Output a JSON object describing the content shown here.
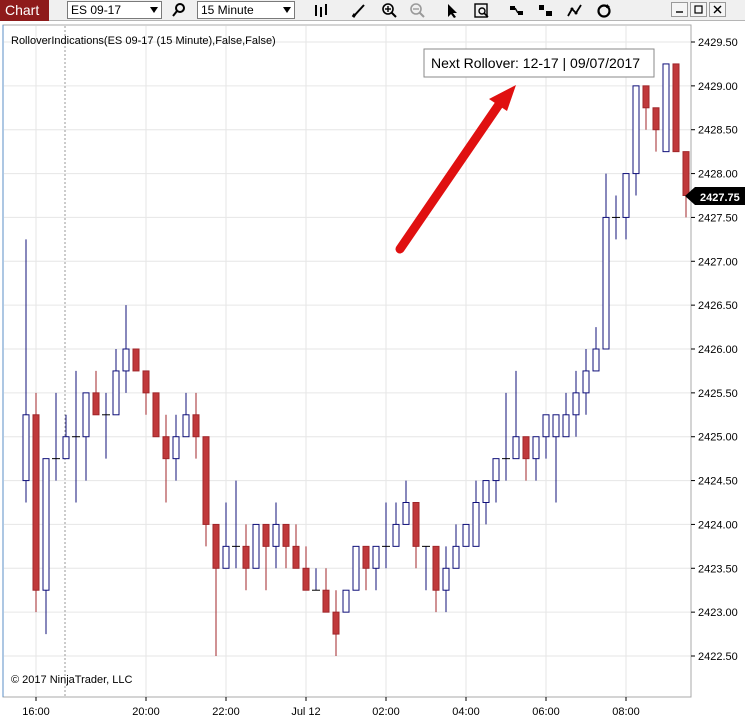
{
  "toolbar": {
    "chart_tab": "Chart",
    "instrument": "ES 09-17",
    "interval": "15 Minute",
    "icons": [
      "search-icon",
      "bar-type-icon",
      "draw-icon",
      "zoom-in-icon",
      "zoom-out-icon",
      "pointer-icon",
      "data-box-icon",
      "strategies-icon",
      "chart-style-icon",
      "indicators-icon",
      "refresh-icon"
    ]
  },
  "chart": {
    "indicator_label": "RolloverIndications(ES 09-17 (15 Minute),False,False)",
    "annotation": "Next Rollover: 12-17 | 09/07/2017",
    "copyright": "© 2017 NinjaTrader, LLC",
    "last_price": "2427.75",
    "colors": {
      "up": "#ffffff",
      "down": "#c0393b",
      "outline": "#10107a",
      "wick_down": "#a0262a",
      "arrow": "#e01010",
      "tag": "#000000"
    }
  },
  "chart_data": {
    "type": "candlestick",
    "y_ticks": [
      "2422.50",
      "2423.00",
      "2423.50",
      "2424.00",
      "2424.50",
      "2425.00",
      "2425.50",
      "2426.00",
      "2426.50",
      "2427.00",
      "2427.50",
      "2428.00",
      "2428.50",
      "2429.00",
      "2429.50"
    ],
    "ylim": [
      2422.2,
      2429.8
    ],
    "x_ticks": [
      "16:00",
      "20:00",
      "22:00",
      "Jul 12",
      "02:00",
      "04:00",
      "06:00",
      "08:00"
    ],
    "candles": [
      [
        2424.5,
        2427.25,
        2424.25,
        2425.25
      ],
      [
        2425.25,
        2425.5,
        2423.0,
        2423.25
      ],
      [
        2423.25,
        2424.75,
        2422.75,
        2424.75
      ],
      [
        2424.75,
        2425.5,
        2424.5,
        2424.75
      ],
      [
        2424.75,
        2425.25,
        2424.75,
        2425.0
      ],
      [
        2425.0,
        2425.75,
        2424.25,
        2425.0
      ],
      [
        2425.0,
        2425.5,
        2424.5,
        2425.5
      ],
      [
        2425.5,
        2425.75,
        2425.25,
        2425.25
      ],
      [
        2425.25,
        2425.5,
        2424.75,
        2425.25
      ],
      [
        2425.25,
        2426.0,
        2425.25,
        2425.75
      ],
      [
        2425.75,
        2426.5,
        2425.5,
        2426.0
      ],
      [
        2426.0,
        2426.0,
        2425.75,
        2425.75
      ],
      [
        2425.75,
        2425.75,
        2425.25,
        2425.5
      ],
      [
        2425.5,
        2425.5,
        2425.0,
        2425.0
      ],
      [
        2425.0,
        2425.25,
        2424.25,
        2424.75
      ],
      [
        2424.75,
        2425.25,
        2424.5,
        2425.0
      ],
      [
        2425.0,
        2425.5,
        2425.0,
        2425.25
      ],
      [
        2425.25,
        2425.5,
        2424.75,
        2425.0
      ],
      [
        2425.0,
        2425.0,
        2423.75,
        2424.0
      ],
      [
        2424.0,
        2424.0,
        2422.5,
        2423.5
      ],
      [
        2423.5,
        2424.25,
        2423.5,
        2423.75
      ],
      [
        2423.75,
        2424.5,
        2423.5,
        2423.75
      ],
      [
        2423.75,
        2424.0,
        2423.25,
        2423.5
      ],
      [
        2423.5,
        2424.0,
        2423.5,
        2424.0
      ],
      [
        2424.0,
        2424.0,
        2423.25,
        2423.75
      ],
      [
        2423.75,
        2424.25,
        2423.5,
        2424.0
      ],
      [
        2424.0,
        2424.0,
        2423.5,
        2423.75
      ],
      [
        2423.75,
        2424.0,
        2423.5,
        2423.5
      ],
      [
        2423.5,
        2423.75,
        2423.25,
        2423.25
      ],
      [
        2423.25,
        2423.5,
        2423.25,
        2423.25
      ],
      [
        2423.25,
        2423.5,
        2423.0,
        2423.0
      ],
      [
        2423.0,
        2423.25,
        2422.5,
        2422.75
      ],
      [
        2423.0,
        2423.25,
        2423.0,
        2423.25
      ],
      [
        2423.25,
        2423.75,
        2423.25,
        2423.75
      ],
      [
        2423.75,
        2423.75,
        2423.25,
        2423.5
      ],
      [
        2423.5,
        2423.75,
        2423.25,
        2423.75
      ],
      [
        2423.75,
        2424.25,
        2423.5,
        2423.75
      ],
      [
        2423.75,
        2424.25,
        2423.75,
        2424.0
      ],
      [
        2424.0,
        2424.5,
        2424.0,
        2424.25
      ],
      [
        2424.25,
        2424.25,
        2423.5,
        2423.75
      ],
      [
        2423.75,
        2423.75,
        2423.25,
        2423.75
      ],
      [
        2423.75,
        2423.75,
        2423.0,
        2423.25
      ],
      [
        2423.25,
        2423.75,
        2423.0,
        2423.5
      ],
      [
        2423.5,
        2424.0,
        2423.5,
        2423.75
      ],
      [
        2423.75,
        2424.0,
        2423.75,
        2424.0
      ],
      [
        2423.75,
        2424.5,
        2423.75,
        2424.25
      ],
      [
        2424.25,
        2424.5,
        2424.0,
        2424.5
      ],
      [
        2424.5,
        2424.75,
        2424.25,
        2424.75
      ],
      [
        2424.75,
        2425.5,
        2424.5,
        2424.75
      ],
      [
        2424.75,
        2425.75,
        2424.75,
        2425.0
      ],
      [
        2425.0,
        2425.0,
        2424.5,
        2424.75
      ],
      [
        2424.75,
        2425.0,
        2424.5,
        2425.0
      ],
      [
        2425.0,
        2425.25,
        2424.75,
        2425.25
      ],
      [
        2425.0,
        2425.25,
        2424.25,
        2425.25
      ],
      [
        2425.0,
        2425.5,
        2425.0,
        2425.25
      ],
      [
        2425.25,
        2425.75,
        2425.0,
        2425.5
      ],
      [
        2425.5,
        2426.0,
        2425.25,
        2425.75
      ],
      [
        2425.75,
        2426.25,
        2425.75,
        2426.0
      ],
      [
        2426.0,
        2428.0,
        2426.0,
        2427.5
      ],
      [
        2427.5,
        2427.75,
        2427.25,
        2427.5
      ],
      [
        2427.5,
        2428.0,
        2427.25,
        2428.0
      ],
      [
        2428.0,
        2429.0,
        2427.75,
        2429.0
      ],
      [
        2429.0,
        2429.0,
        2428.5,
        2428.75
      ],
      [
        2428.75,
        2428.75,
        2428.25,
        2428.5
      ],
      [
        2428.25,
        2429.25,
        2428.25,
        2429.25
      ],
      [
        2429.25,
        2429.25,
        2428.25,
        2428.25
      ],
      [
        2428.25,
        2428.25,
        2427.5,
        2427.75
      ],
      [
        2427.75,
        2427.75,
        2427.75,
        2427.75
      ]
    ]
  }
}
